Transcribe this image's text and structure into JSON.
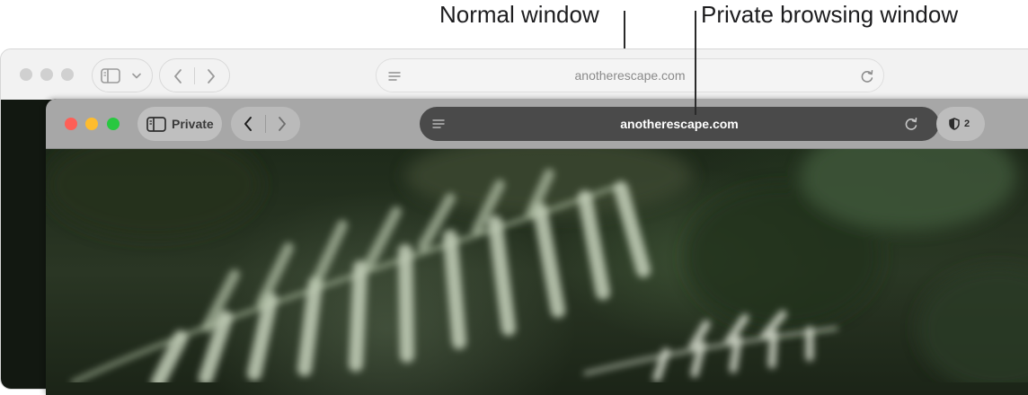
{
  "callouts": {
    "normal_window": "Normal window",
    "private_window": "Private browsing window"
  },
  "normal_window": {
    "address": "anotherescape.com",
    "icons": [
      "sidebar-icon",
      "chevron-down-icon",
      "back-icon",
      "forward-icon",
      "reader-icon",
      "reload-icon"
    ]
  },
  "private_window": {
    "sidebar_label": "Private",
    "address": "anotherescape.com",
    "privacy_count": "2",
    "icons": [
      "sidebar-icon",
      "back-icon",
      "forward-icon",
      "reader-icon",
      "reload-icon",
      "shield-icon"
    ]
  },
  "colors": {
    "close": "#fe5f57",
    "minimize": "#febc2e",
    "zoom": "#28c840",
    "private_toolbar": "#a7a7a7",
    "private_address_bar": "#4a4a4a"
  }
}
